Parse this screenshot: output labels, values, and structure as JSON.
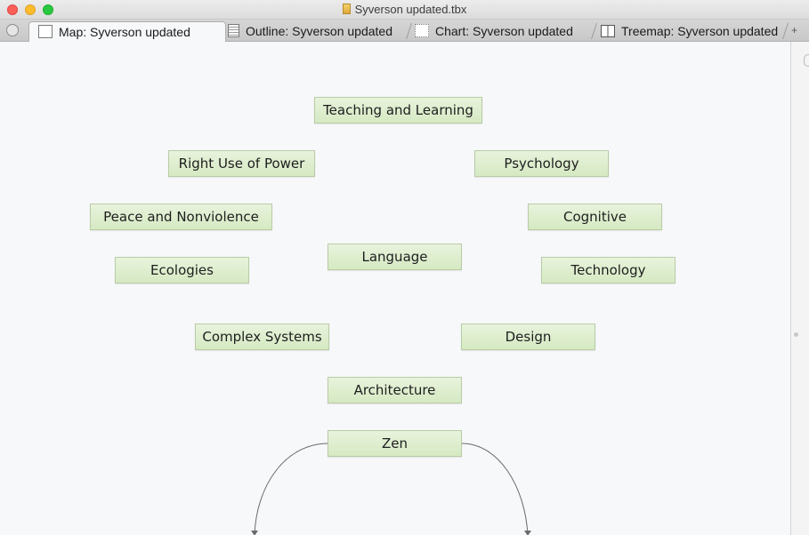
{
  "window": {
    "title": "Syverson updated.tbx"
  },
  "tabs": [
    {
      "label": "Map: Syverson updated",
      "icon": "map-icon",
      "active": true
    },
    {
      "label": "Outline: Syverson updated",
      "icon": "outline-icon",
      "active": false
    },
    {
      "label": "Chart: Syverson updated",
      "icon": "chart-icon",
      "active": false
    },
    {
      "label": "Treemap: Syverson updated",
      "icon": "treemap-icon",
      "active": false
    }
  ],
  "tab_add_label": "+",
  "notes": [
    {
      "label": "Teaching and Learning"
    },
    {
      "label": "Right Use of Power"
    },
    {
      "label": "Psychology"
    },
    {
      "label": "Peace and Nonviolence"
    },
    {
      "label": "Cognitive"
    },
    {
      "label": "Language"
    },
    {
      "label": "Ecologies"
    },
    {
      "label": "Technology"
    },
    {
      "label": "Complex Systems"
    },
    {
      "label": "Design"
    },
    {
      "label": "Architecture"
    },
    {
      "label": "Zen"
    }
  ],
  "colors": {
    "note_fill_top": "#e8f3dc",
    "note_fill_bottom": "#d5e9c2",
    "note_border": "#b8cca6",
    "link_color": "#6a6a6a",
    "canvas_bg": "#f7f8fa"
  }
}
